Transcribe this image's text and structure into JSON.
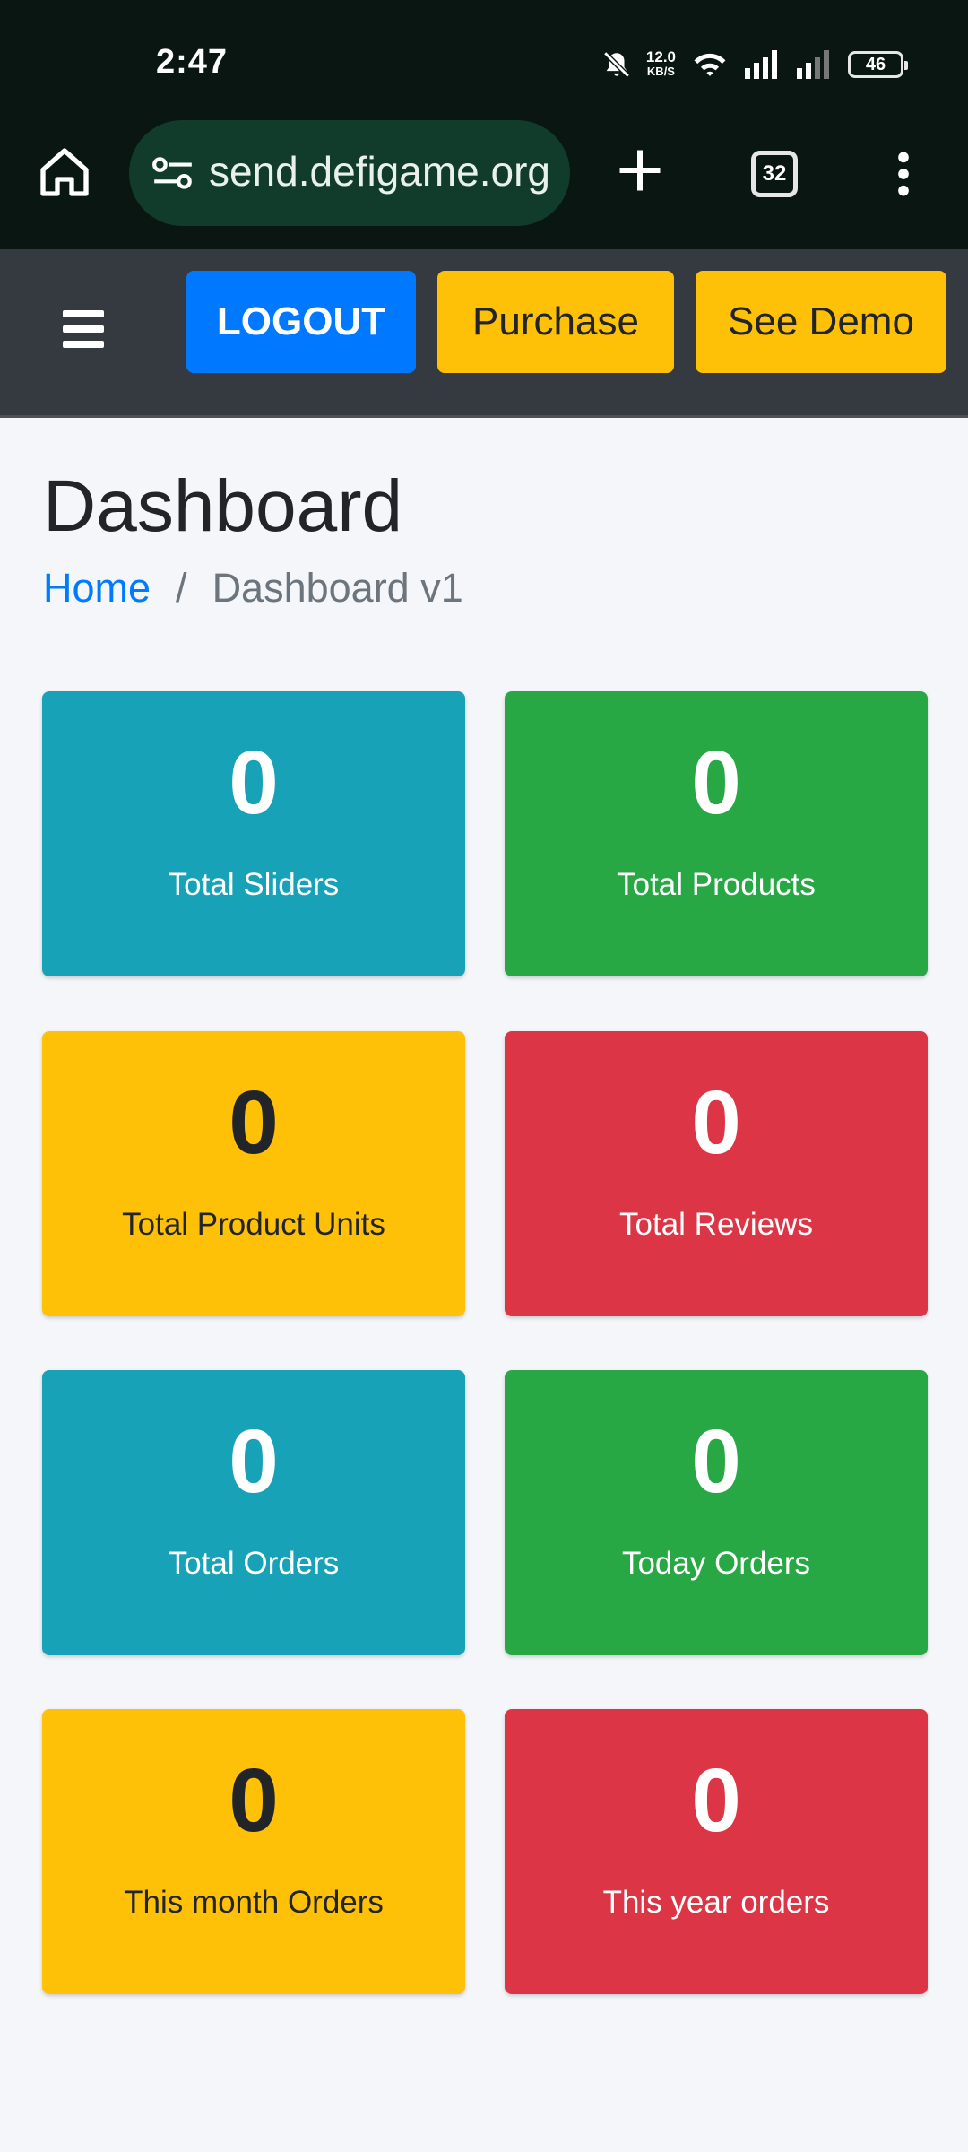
{
  "status_bar": {
    "time": "2:47",
    "network_speed_value": "12.0",
    "network_speed_unit": "KB/S",
    "battery": "46",
    "icons": [
      "mute-icon",
      "wifi-icon",
      "signal-icon",
      "signal-icon"
    ]
  },
  "browser": {
    "url": "send.defigame.org",
    "tab_count": "32",
    "icons": [
      "home-icon",
      "site-settings-icon",
      "plus-icon",
      "more-vert-icon"
    ]
  },
  "navbar": {
    "logout_label": "LOGOUT",
    "purchase_label": "Purchase",
    "demo_label": "See Demo",
    "colors": {
      "background": "#343a40",
      "logout": "#0078ff",
      "accent": "#ffc107"
    }
  },
  "page": {
    "title": "Dashboard",
    "breadcrumb": {
      "home": "Home",
      "separator": "/",
      "current": "Dashboard v1"
    }
  },
  "cards": [
    {
      "value": "0",
      "label": "Total Sliders",
      "color": "#17a2b8"
    },
    {
      "value": "0",
      "label": "Total Products",
      "color": "#28a745"
    },
    {
      "value": "0",
      "label": "Total Product Units",
      "color": "#ffc107"
    },
    {
      "value": "0",
      "label": "Total Reviews",
      "color": "#dc3545"
    },
    {
      "value": "0",
      "label": "Total Orders",
      "color": "#17a2b8"
    },
    {
      "value": "0",
      "label": "Today Orders",
      "color": "#28a745"
    },
    {
      "value": "0",
      "label": "This month Orders",
      "color": "#ffc107"
    },
    {
      "value": "0",
      "label": "This year orders",
      "color": "#dc3545"
    }
  ]
}
